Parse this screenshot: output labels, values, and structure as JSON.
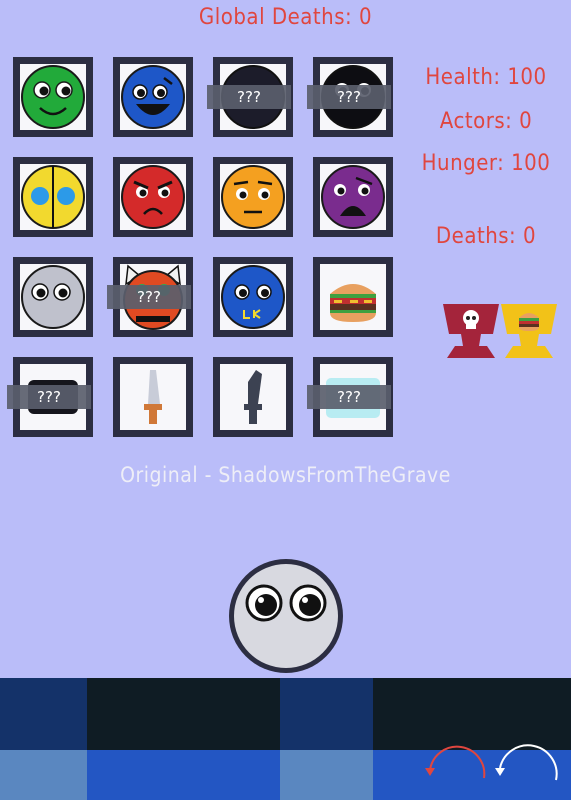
{
  "hud": {
    "global_deaths": "Global Deaths: 0",
    "health": "Health: 100",
    "actors": "Actors: 0",
    "hunger": "Hunger: 100",
    "deaths": "Deaths: 0"
  },
  "grid": {
    "locked_label": "???",
    "cells": [
      {
        "name": "green-smiley-actor",
        "locked": false
      },
      {
        "name": "blue-grinning-actor",
        "locked": false
      },
      {
        "name": "dark-actor",
        "locked": true
      },
      {
        "name": "black-actor",
        "locked": true
      },
      {
        "name": "yellow-actor",
        "locked": false
      },
      {
        "name": "red-angry-actor",
        "locked": false
      },
      {
        "name": "orange-worried-actor",
        "locked": false
      },
      {
        "name": "purple-shocked-actor",
        "locked": false
      },
      {
        "name": "gray-actor",
        "locked": false
      },
      {
        "name": "horned-red-actor",
        "locked": true
      },
      {
        "name": "blue-grumpy-actor",
        "locked": false
      },
      {
        "name": "burger-item",
        "locked": false
      },
      {
        "name": "black-item",
        "locked": true
      },
      {
        "name": "knife-item",
        "locked": false
      },
      {
        "name": "dark-knife-item",
        "locked": false
      },
      {
        "name": "light-blue-item",
        "locked": true
      }
    ]
  },
  "credit": "Original - ShadowsFromTheGrave",
  "trophies": [
    {
      "icon": "skull-trophy-icon",
      "color": "#a4243b"
    },
    {
      "icon": "burger-trophy-icon",
      "color": "#f2c218"
    }
  ],
  "colors": {
    "background": "#babdf9",
    "accent_text": "#e0463f",
    "floor_dark": "#0f1c24",
    "floor_blue": "#143269",
    "floor_light": "#5a87c0",
    "floor_bright": "#2356c3"
  }
}
